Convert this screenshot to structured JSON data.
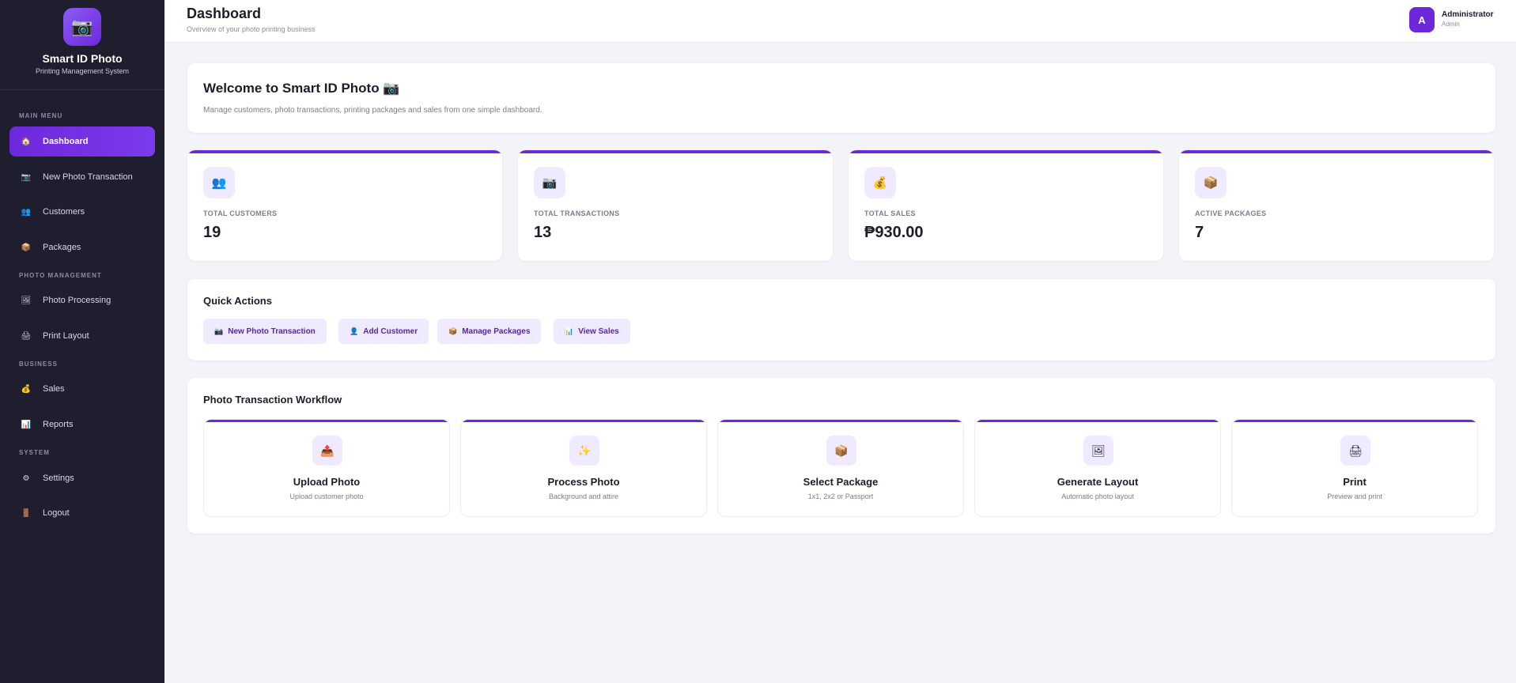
{
  "brand": {
    "logo_icon": "camera-icon",
    "name": "Smart ID Photo",
    "subtitle": "Printing Management System"
  },
  "sidebar": {
    "sections": {
      "main": "MAIN MENU",
      "photo": "PHOTO MANAGEMENT",
      "business": "BUSINESS",
      "system": "SYSTEM"
    },
    "items": [
      {
        "label": "Dashboard",
        "icon": "home-icon",
        "active": true
      },
      {
        "label": "New Photo Transaction",
        "icon": "camera-icon",
        "active": false
      },
      {
        "label": "Customers",
        "icon": "users-icon",
        "active": false
      },
      {
        "label": "Packages",
        "icon": "package-icon",
        "active": false
      },
      {
        "label": "Photo Processing",
        "icon": "image-icon",
        "active": false
      },
      {
        "label": "Print Layout",
        "icon": "printer-icon",
        "active": false
      },
      {
        "label": "Sales",
        "icon": "money-bag-icon",
        "active": false
      },
      {
        "label": "Reports",
        "icon": "bar-chart-icon",
        "active": false
      },
      {
        "label": "Settings",
        "icon": "gear-icon",
        "active": false
      },
      {
        "label": "Logout",
        "icon": "door-icon",
        "active": false
      }
    ]
  },
  "header": {
    "title": "Dashboard",
    "subtitle": "Overview of your photo printing business",
    "user": {
      "initial": "A",
      "name": "Administrator",
      "role": "Admin"
    }
  },
  "welcome": {
    "title": "Welcome to Smart ID Photo 📷",
    "text": "Manage customers, photo transactions, printing packages and sales from one simple dashboard."
  },
  "stats": [
    {
      "label": "TOTAL CUSTOMERS",
      "value": "19",
      "icon": "users-icon"
    },
    {
      "label": "TOTAL TRANSACTIONS",
      "value": "13",
      "icon": "camera-icon"
    },
    {
      "label": "TOTAL SALES",
      "value": "₱930.00",
      "icon": "money-bag-icon"
    },
    {
      "label": "ACTIVE PACKAGES",
      "value": "7",
      "icon": "package-icon"
    }
  ],
  "quick_actions": {
    "title": "Quick Actions",
    "buttons": [
      {
        "label": "New Photo Transaction",
        "icon": "camera-icon"
      },
      {
        "label": "Add Customer",
        "icon": "user-icon"
      },
      {
        "label": "Manage Packages",
        "icon": "package-icon"
      },
      {
        "label": "View Sales",
        "icon": "bar-chart-icon"
      }
    ]
  },
  "workflow": {
    "title": "Photo Transaction Workflow",
    "steps": [
      {
        "title": "Upload Photo",
        "subtitle": "Upload customer photo",
        "icon": "upload-icon"
      },
      {
        "title": "Process Photo",
        "subtitle": "Background and attire",
        "icon": "sparkles-icon"
      },
      {
        "title": "Select Package",
        "subtitle": "1x1, 2x2 or Passport",
        "icon": "package-icon"
      },
      {
        "title": "Generate Layout",
        "subtitle": "Automatic photo layout",
        "icon": "image-icon"
      },
      {
        "title": "Print",
        "subtitle": "Preview and print",
        "icon": "printer-icon"
      }
    ]
  },
  "colors": {
    "accent": "#6d28d9",
    "sidebar_bg": "#1e1e2f",
    "page_bg": "#f3f4f8",
    "icon_tint": "#efeaff"
  }
}
